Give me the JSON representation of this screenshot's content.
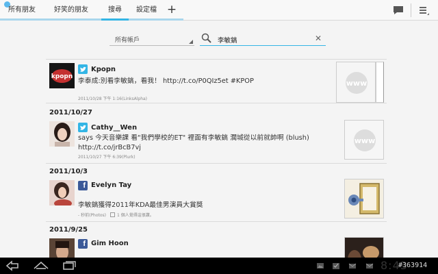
{
  "tabs": [
    {
      "label": "所有朋友"
    },
    {
      "label": "好笑的朋友"
    },
    {
      "label": "搜尋"
    },
    {
      "label": "設定檔"
    }
  ],
  "add_tab_label": "+",
  "filters": {
    "account_select": "所有帳戶",
    "search_query": "李敏鎬",
    "clear_label": "✕"
  },
  "posts": [
    {
      "author": "Kpopn",
      "service": "twitter",
      "text": "李泰成:別看李敏鎬，看我！ http://t.co/P0QIz5et #KPOP",
      "meta": "2011/10/28 下午 1:16(LinksAlpha)",
      "avatar_text": "kpopn",
      "thumb_text": "www"
    },
    {
      "date": "2011/10/27",
      "author": "Cathy__Wen",
      "service": "twitter",
      "text": "says 今天音樂課 看\"我們學校的ET\" 裡面有李敏鎬 濶城從以前就帥啊 (blush) http://t.co/jrBcB7vj",
      "meta": "2011/10/27 下午 6:39(Plurk)",
      "thumb_text": "www"
    },
    {
      "date": "2011/10/3",
      "author": "Evelyn Tay",
      "service": "facebook",
      "text": "李敏鎬獲得2011年KDA最佳男演員大賞獎",
      "meta": "- 秒前(Photos)",
      "likes": "1 個人覺得這很讚。"
    },
    {
      "date": "2011/9/25",
      "author": "Gim Hoon",
      "service": "facebook"
    }
  ],
  "system": {
    "clock": "8:43",
    "watermark": "#363914"
  },
  "colors": {
    "accent": "#33b5e5",
    "twitter": "#33b5e5",
    "facebook": "#3b5998"
  }
}
